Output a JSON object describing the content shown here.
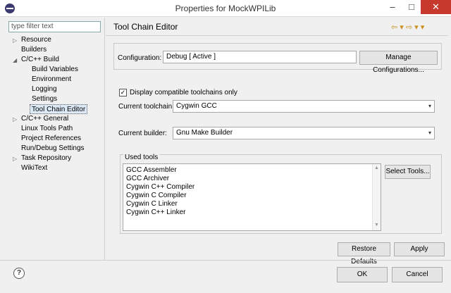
{
  "window": {
    "title": "Properties for MockWPILib",
    "min_glyph": "–",
    "max_glyph": "□",
    "close_glyph": "✕"
  },
  "sidebar": {
    "filter_placeholder": "type filter text",
    "items": [
      {
        "label": "Resource",
        "toggle": "▷"
      },
      {
        "label": "Builders",
        "toggle": ""
      },
      {
        "label": "C/C++ Build",
        "toggle": "◢"
      },
      {
        "label": "Build Variables",
        "toggle": ""
      },
      {
        "label": "Environment",
        "toggle": ""
      },
      {
        "label": "Logging",
        "toggle": ""
      },
      {
        "label": "Settings",
        "toggle": ""
      },
      {
        "label": "Tool Chain Editor",
        "toggle": ""
      },
      {
        "label": "C/C++ General",
        "toggle": "▷"
      },
      {
        "label": "Linux Tools Path",
        "toggle": ""
      },
      {
        "label": "Project References",
        "toggle": ""
      },
      {
        "label": "Run/Debug Settings",
        "toggle": ""
      },
      {
        "label": "Task Repository",
        "toggle": "▷"
      },
      {
        "label": "WikiText",
        "toggle": ""
      }
    ]
  },
  "main": {
    "title": "Tool Chain Editor",
    "nav_glyphs": "⇦ ▾ ⇨ ▾ ▾",
    "configuration_label": "Configuration:",
    "configuration_value": "Debug  [ Active ]",
    "manage_button": "Manage Configurations...",
    "checkbox_label": "Display compatible toolchains only",
    "checkbox_mark": "✓",
    "toolchain_label": "Current toolchain:",
    "toolchain_value": "Cygwin GCC",
    "builder_label": "Current builder:",
    "builder_value": "Gnu Make Builder",
    "used_tools_label": "Used tools",
    "tools": [
      "GCC Assembler",
      "GCC Archiver",
      "Cygwin C++ Compiler",
      "Cygwin C Compiler",
      "Cygwin C Linker",
      "Cygwin C++ Linker"
    ],
    "select_tools_button": "Select Tools...",
    "restore_button": "Restore Defaults",
    "apply_button": "Apply",
    "dropdown_glyph": "▾",
    "scroll_up": "▲",
    "scroll_down": "▼"
  },
  "footer": {
    "help_glyph": "?",
    "ok_button": "OK",
    "cancel_button": "Cancel"
  }
}
